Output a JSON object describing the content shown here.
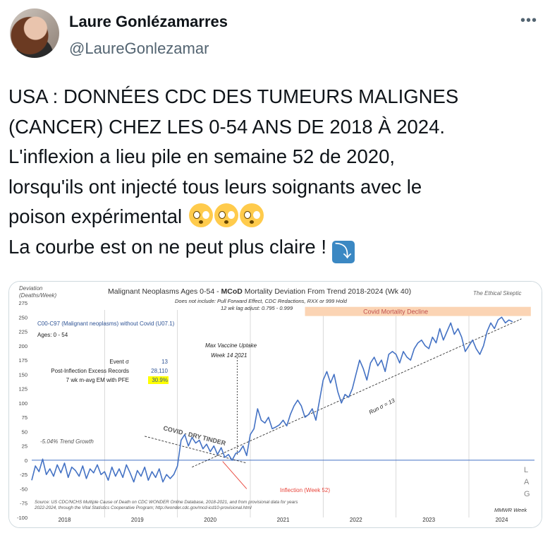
{
  "user": {
    "name": "Laure Gonlézamarres",
    "handle": "@LaureGonlezamar"
  },
  "more_icon": "more-horizontal-icon",
  "tweet": {
    "lines": [
      "USA : DONNÉES CDC DES TUMEURS MALIGNES",
      "(CANCER) CHEZ LES 0-54 ANS DE 2018 À 2024.",
      "L'inflexion a lieu pile en semaine 52 de 2020,",
      "lorsqu'ils ont injecté tous leurs soignants avec le",
      "poison expérimental",
      "La courbe est on ne peut plus claire !"
    ],
    "emoji": [
      "flushed-face-emoji",
      "flushed-face-emoji",
      "flushed-face-emoji"
    ],
    "end_icon": "arrow-down-right-icon"
  },
  "chart_data": {
    "type": "line",
    "title_prefix": "Malignant Neoplasms Ages 0-54 - ",
    "title_bold": "MCoD",
    "title_suffix": " Mortality Deviation From Trend  2018-2024 (Wk 40)",
    "watermark": "The Ethical Skeptic",
    "subtitle1": "Does not include: Pull Forward Effect,  CDC Redactions, RXX or 999 Hold",
    "subtitle2": "12 wk lag adjust: 0.795 - 0.999",
    "ylabel1": "Deviation",
    "ylabel2": "(Deaths/Week)",
    "ylim": [
      -100,
      275
    ],
    "yticks": [
      275,
      250,
      225,
      200,
      175,
      150,
      125,
      100,
      75,
      50,
      25,
      0,
      -25,
      -50,
      -75,
      -100
    ],
    "xticks": [
      "2018",
      "2019",
      "2020",
      "2021",
      "2022",
      "2023",
      "2024"
    ],
    "xlabel": "MMWR Week",
    "series_name": "C00-C97 (Malignant neoplasms) without Covid (U07.1)",
    "ages": "Ages: 0 - 54",
    "stats": [
      {
        "label": "Event σ",
        "value": "13"
      },
      {
        "label": "Post-Inflection Excess Records",
        "value": "28,110"
      },
      {
        "label": "7 wk m-avg EM with PFE",
        "value": "30.9%"
      }
    ],
    "annotations": {
      "covid_decline": "Covid Mortality Decline",
      "vaccine": [
        "Max Vaccine Uptake",
        "Week 14 2021"
      ],
      "dry_tinder": "COVID - DRY TINDER",
      "trend_growth": "-5.04% Trend Growth",
      "run_sigma": "Run σ = 13",
      "inflection": "Inflection (Week 52)",
      "lag": [
        "L",
        "A",
        "G"
      ]
    },
    "source1": "Source: US CDC/NCHS Multiple Cause of Death on CDC WONDER Online Database, 2018-2021, and from provisional data for years",
    "source2": "2022-2024, through the Vital Statistics Cooperative Program; http://wonder.cdc.gov/mcd-icd10-provisional.html",
    "colors": {
      "line": "#4472c4",
      "highlight": "#fbd4b4",
      "accent": "#e8443a",
      "yellow": "#ffff00"
    },
    "x": [
      2018.0,
      2018.05,
      2018.1,
      2018.15,
      2018.2,
      2018.25,
      2018.3,
      2018.35,
      2018.4,
      2018.45,
      2018.5,
      2018.55,
      2018.6,
      2018.65,
      2018.7,
      2018.75,
      2018.8,
      2018.85,
      2018.9,
      2018.95,
      2019.0,
      2019.05,
      2019.1,
      2019.15,
      2019.2,
      2019.25,
      2019.3,
      2019.35,
      2019.4,
      2019.45,
      2019.5,
      2019.55,
      2019.6,
      2019.65,
      2019.7,
      2019.75,
      2019.8,
      2019.85,
      2019.9,
      2019.95,
      2020.0,
      2020.05,
      2020.1,
      2020.15,
      2020.2,
      2020.25,
      2020.3,
      2020.35,
      2020.4,
      2020.45,
      2020.5,
      2020.55,
      2020.6,
      2020.65,
      2020.7,
      2020.75,
      2020.8,
      2020.85,
      2020.9,
      2020.95,
      2021.0,
      2021.05,
      2021.1,
      2021.15,
      2021.2,
      2021.25,
      2021.3,
      2021.35,
      2021.4,
      2021.45,
      2021.5,
      2021.55,
      2021.6,
      2021.65,
      2021.7,
      2021.75,
      2021.8,
      2021.85,
      2021.9,
      2021.95,
      2022.0,
      2022.05,
      2022.1,
      2022.15,
      2022.2,
      2022.25,
      2022.3,
      2022.35,
      2022.4,
      2022.45,
      2022.5,
      2022.55,
      2022.6,
      2022.65,
      2022.7,
      2022.75,
      2022.8,
      2022.85,
      2022.9,
      2022.95,
      2023.0,
      2023.05,
      2023.1,
      2023.15,
      2023.2,
      2023.25,
      2023.3,
      2023.35,
      2023.4,
      2023.45,
      2023.5,
      2023.55,
      2023.6,
      2023.65,
      2023.7,
      2023.75,
      2023.8,
      2023.85,
      2023.9,
      2023.95,
      2024.0,
      2024.05,
      2024.1,
      2024.15,
      2024.2,
      2024.25,
      2024.3,
      2024.35,
      2024.4,
      2024.45,
      2024.5,
      2024.55,
      2024.6
    ],
    "values": [
      -35,
      -10,
      -20,
      2,
      -25,
      -15,
      -28,
      -8,
      -22,
      -5,
      -30,
      -12,
      -18,
      -28,
      -10,
      -32,
      -15,
      -22,
      -8,
      -25,
      -20,
      -35,
      -12,
      -28,
      -15,
      -30,
      -8,
      -22,
      -38,
      -18,
      -28,
      -12,
      -35,
      -20,
      -30,
      -15,
      -38,
      -25,
      -32,
      -25,
      -10,
      35,
      45,
      25,
      40,
      30,
      35,
      20,
      28,
      15,
      25,
      10,
      22,
      5,
      10,
      0,
      12,
      15,
      25,
      8,
      45,
      55,
      90,
      70,
      65,
      75,
      55,
      58,
      62,
      70,
      60,
      80,
      95,
      105,
      95,
      75,
      80,
      90,
      70,
      105,
      140,
      155,
      135,
      150,
      120,
      100,
      115,
      110,
      125,
      150,
      175,
      160,
      140,
      170,
      180,
      165,
      175,
      155,
      185,
      190,
      185,
      170,
      190,
      180,
      175,
      195,
      205,
      210,
      200,
      195,
      215,
      205,
      230,
      210,
      225,
      240,
      220,
      230,
      215,
      190,
      200,
      210,
      195,
      185,
      200,
      225,
      240,
      230,
      245,
      250,
      240,
      245,
      242
    ]
  }
}
